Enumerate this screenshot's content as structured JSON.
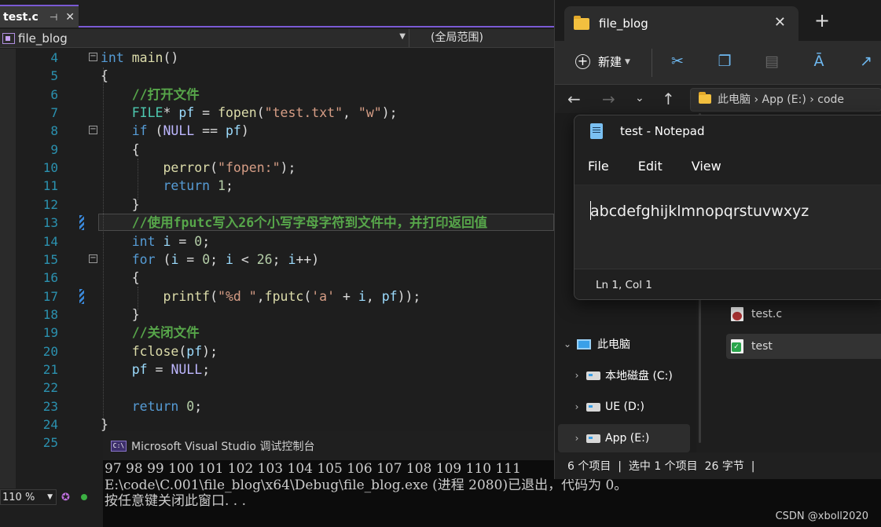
{
  "vs": {
    "tab_title": "test.c",
    "tab_pin": "⊣",
    "tab_close": "✕",
    "project": "file_blog",
    "scope": "(全局范围)",
    "zoom": "110 %",
    "code_lines": [
      {
        "n": "4",
        "html": "<span class='kw'>int</span> <span class='fn'>main</span>()"
      },
      {
        "n": "5",
        "html": "{"
      },
      {
        "n": "6",
        "html": "    <span class='cm'>//打开文件</span>"
      },
      {
        "n": "7",
        "html": "    <span class='ty'>FILE</span>* <span class='var'>pf</span> = <span class='fn'>fopen</span>(<span class='str'>\"test.txt\"</span>, <span class='str'>\"w\"</span>);"
      },
      {
        "n": "8",
        "html": "    <span class='kw'>if</span> (<span class='mac'>NULL</span> == <span class='var'>pf</span>)"
      },
      {
        "n": "9",
        "html": "    {"
      },
      {
        "n": "10",
        "html": "        <span class='fn'>perror</span>(<span class='str'>\"fopen:\"</span>);"
      },
      {
        "n": "11",
        "html": "        <span class='kw'>return</span> <span class='num'>1</span>;"
      },
      {
        "n": "12",
        "html": "    }"
      },
      {
        "n": "13",
        "html": "    <span class='cm'>//使用fputc写入26个小写字母字符到文件中，并打印返回值</span>"
      },
      {
        "n": "14",
        "html": "    <span class='kw'>int</span> <span class='var'>i</span> = <span class='num'>0</span>;"
      },
      {
        "n": "15",
        "html": "    <span class='kw'>for</span> (<span class='var'>i</span> = <span class='num'>0</span>; <span class='var'>i</span> &lt; <span class='num'>26</span>; <span class='var'>i</span>++)"
      },
      {
        "n": "16",
        "html": "    {"
      },
      {
        "n": "17",
        "html": "        <span class='fn'>printf</span>(<span class='str'>\"%d \"</span>,<span class='fn'>fputc</span>(<span class='str'>'a'</span> + <span class='var'>i</span>, <span class='var'>pf</span>));"
      },
      {
        "n": "18",
        "html": "    }"
      },
      {
        "n": "19",
        "html": "    <span class='cm'>//关闭文件</span>"
      },
      {
        "n": "20",
        "html": "    <span class='fn'>fclose</span>(<span class='var'>pf</span>);"
      },
      {
        "n": "21",
        "html": "    <span class='var'>pf</span> = <span class='mac'>NULL</span>;"
      },
      {
        "n": "22",
        "html": ""
      },
      {
        "n": "23",
        "html": "    <span class='kw'>return</span> <span class='num'>0</span>;"
      },
      {
        "n": "24",
        "html": "}"
      },
      {
        "n": "25",
        "html": ""
      }
    ]
  },
  "console": {
    "title": "Microsoft Visual Studio 调试控制台",
    "icon_text": "C:\\",
    "lines": [
      "97 98 99 100 101 102 103 104 105 106 107 108 109 110 111",
      "E:\\code\\C.001\\file_blog\\x64\\Debug\\file_blog.exe (进程 2080)已退出，代码为 0。",
      "按任意键关闭此窗口. . ."
    ],
    "watermark": "CSDN @xboll2020"
  },
  "explorer": {
    "tab_title": "file_blog",
    "tab_close": "✕",
    "new_tab": "+",
    "new_label": "新建",
    "address": "此电脑 › App (E:) › code",
    "sidebar": [
      {
        "label": "此电脑",
        "icon": "pc-icon"
      },
      {
        "label": "本地磁盘 (C:)",
        "icon": "drive-icon"
      },
      {
        "label": "UE (D:)",
        "icon": "drive-icon"
      },
      {
        "label": "App (E:)",
        "icon": "drive-icon"
      }
    ],
    "files": [
      {
        "name": "test.c",
        "icon": "c-source-file-icon"
      },
      {
        "name": "test",
        "icon": "text-file-icon"
      }
    ],
    "status": "6 个项目  |  选中 1 个项目  26 字节  |"
  },
  "notepad": {
    "title": "test - Notepad",
    "menu": [
      "File",
      "Edit",
      "View"
    ],
    "content": "abcdefghijklmnopqrstuvwxyz",
    "status": "Ln 1, Col 1"
  }
}
